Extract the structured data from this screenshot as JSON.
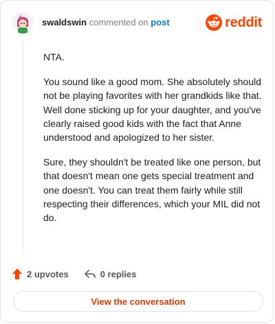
{
  "header": {
    "username": "swaldswin",
    "action_text": "commented on",
    "post_link": "post",
    "brand": "reddit"
  },
  "comment": {
    "paragraphs": [
      "NTA.",
      "You sound like a good mom. She absolutely should not be playing favorites with her grandkids like that. Well done sticking up for your daughter, and you've clearly raised good kids with the fact that Anne understood and apologized to her sister.",
      "Sure, they shouldn't be treated like one person, but that doesn't mean one gets special treatment and one doesn't. You can treat them fairly while still respecting their differences, which your MIL did not do."
    ]
  },
  "footer": {
    "upvotes": "2 upvotes",
    "replies": "0 replies",
    "upvote_icon": "upvote-arrow-icon",
    "reply_icon": "reply-arrow-icon"
  },
  "cta": {
    "label": "View the conversation"
  },
  "colors": {
    "brand": "#ff4500",
    "link": "#0079d3",
    "cta_text": "#d93a00",
    "upvote": "#ff4500"
  }
}
